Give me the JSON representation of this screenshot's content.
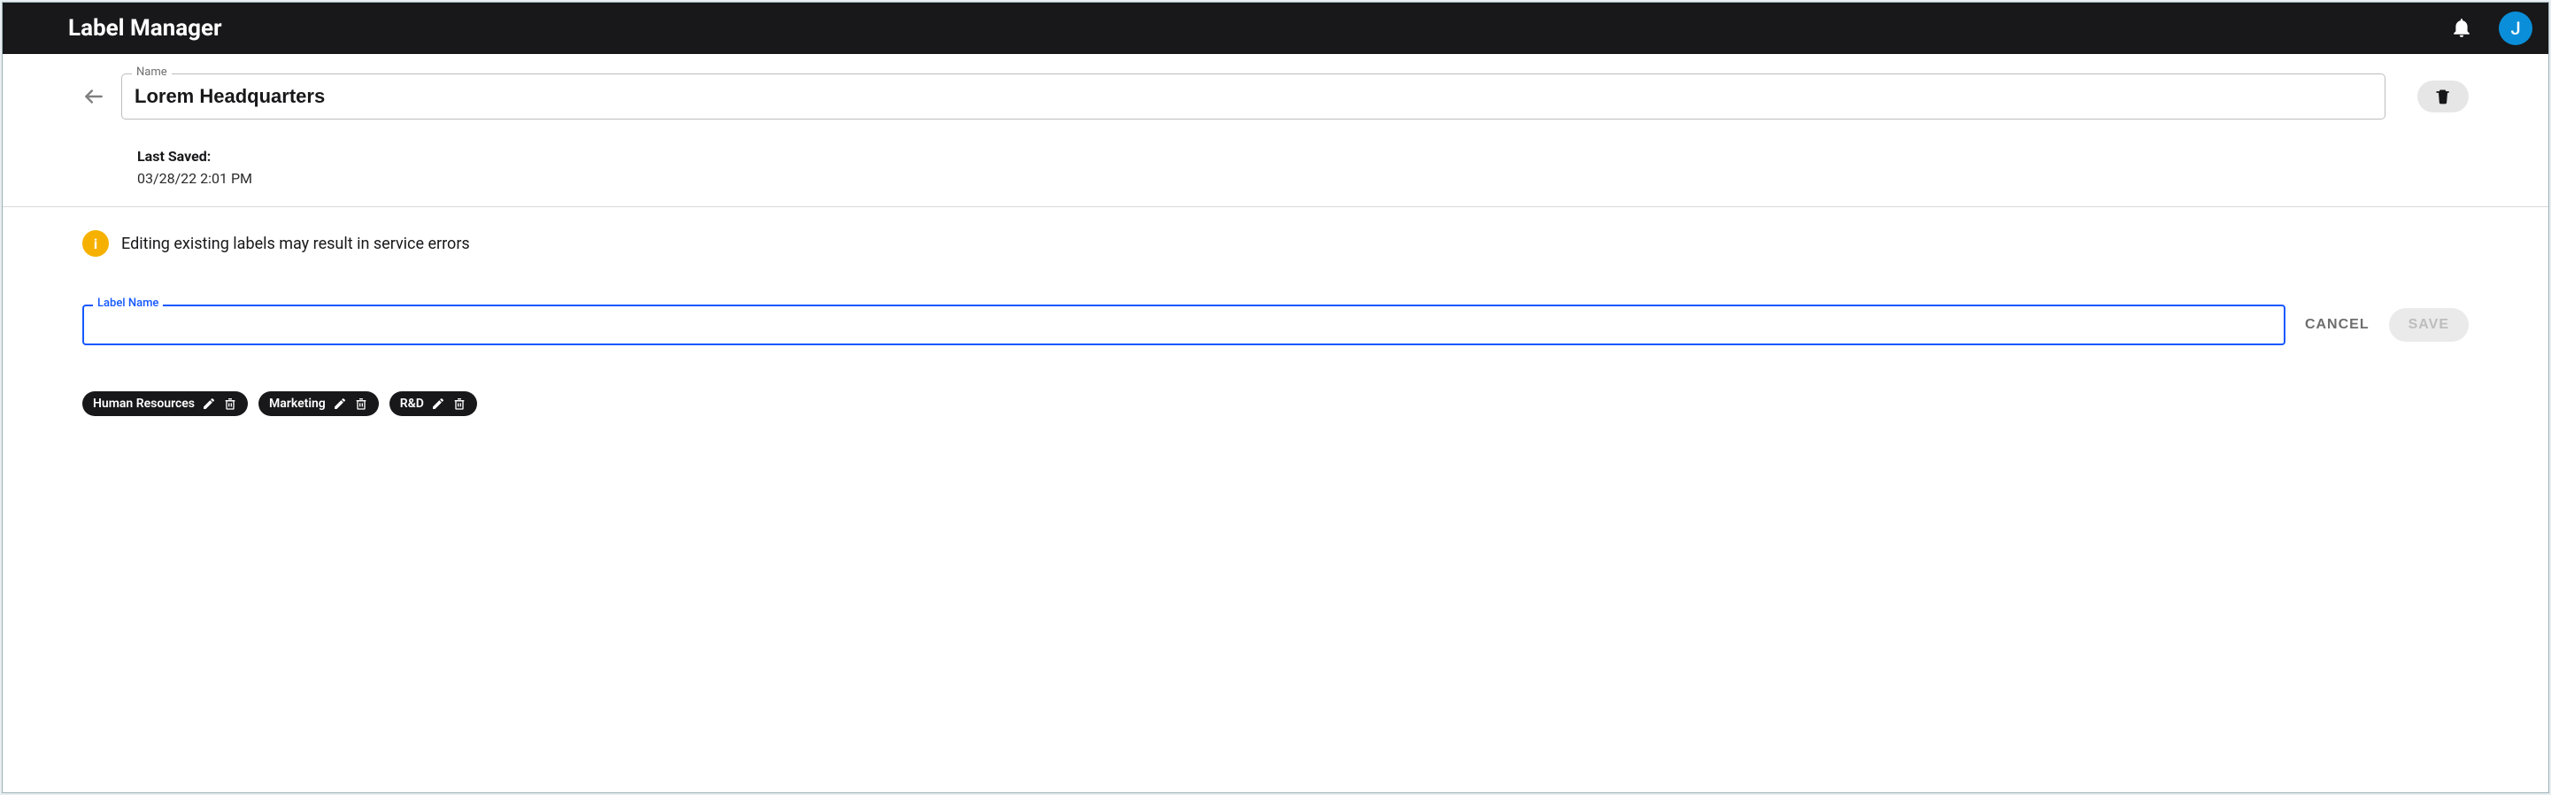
{
  "topbar": {
    "title": "Label Manager",
    "avatar_initial": "J"
  },
  "header": {
    "name_legend": "Name",
    "name_value": "Lorem Headquarters",
    "last_saved_label": "Last Saved:",
    "last_saved_value": "03/28/22 2:01 PM"
  },
  "body": {
    "warning_text": "Editing existing labels may result in service errors",
    "label_name_legend": "Label Name",
    "label_name_value": "",
    "cancel_label": "CANCEL",
    "save_label": "SAVE",
    "chips": [
      {
        "label": "Human Resources"
      },
      {
        "label": "Marketing"
      },
      {
        "label": "R&D"
      }
    ]
  }
}
